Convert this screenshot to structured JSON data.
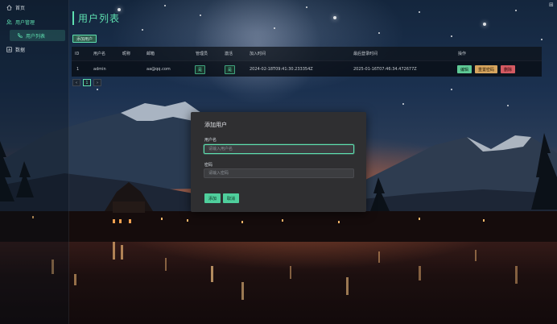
{
  "sidebar": {
    "home_label": "首页",
    "user_mgmt_label": "用户管理",
    "user_list_label": "用户列表",
    "data_label": "数据"
  },
  "main": {
    "title": "用户列表",
    "add_user_label": "添加用户",
    "columns": [
      "ID",
      "用户名",
      "昵称",
      "邮箱",
      "管理员",
      "激活",
      "加入时间",
      "最后登录时间",
      "操作"
    ],
    "rows": [
      {
        "id": "1",
        "username": "admin",
        "nickname": "",
        "email": "aa@qq.com",
        "admin": "是",
        "active": "是",
        "joined": "2024-02-18T09:41:30.233354Z",
        "last_login": "2025-01-16T07:46:34.472677Z",
        "actions": {
          "edit": "编辑",
          "reset_password": "重置密码",
          "delete": "删除"
        }
      }
    ],
    "pagination": {
      "prev": "‹",
      "current": "1",
      "next": "›"
    }
  },
  "modal": {
    "title": "添加用户",
    "username_label": "用户名",
    "username_placeholder": "请输入用户名",
    "password_label": "密码",
    "password_placeholder": "请输入密码",
    "confirm_label": "添加",
    "cancel_label": "取消"
  },
  "colors": {
    "accent": "#5ee0b0",
    "edit": "#5ec995",
    "reset": "#d7a55e",
    "delete": "#d45a62",
    "modal_bg": "#2f2f31"
  },
  "icons": {
    "home": "home-icon",
    "user_mgmt": "users-icon",
    "user_list": "phone-icon",
    "data": "chart-icon",
    "corner": "expand-icon"
  }
}
